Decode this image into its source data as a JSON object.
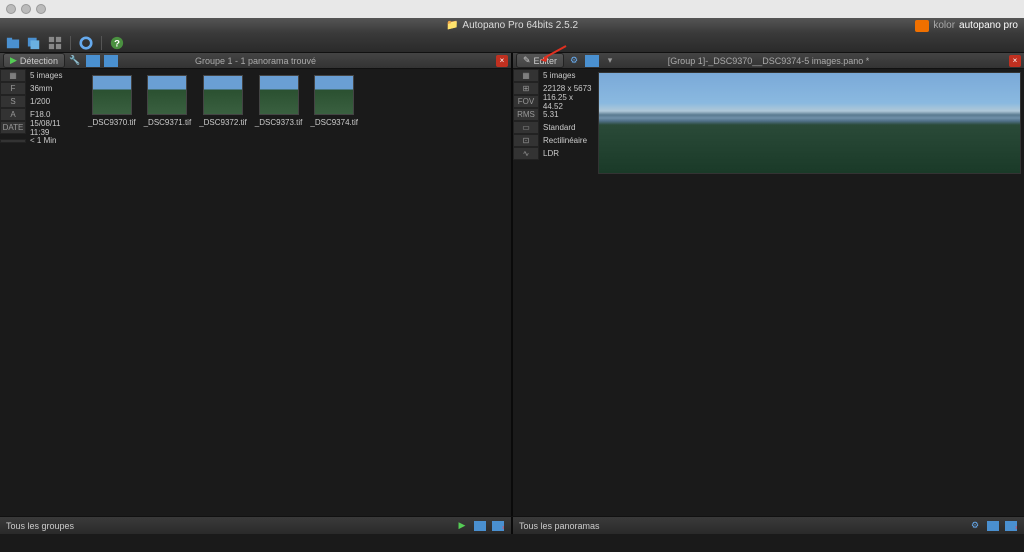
{
  "app": {
    "title": "Autopano Pro 64bits 2.5.2",
    "brand_prefix": "kolor",
    "brand_name": "autopano pro"
  },
  "left_pane": {
    "header_label": "Détection",
    "title": "Groupe 1 - 1 panorama trouvé",
    "meta": [
      {
        "key": "▦",
        "val": "5 images"
      },
      {
        "key": "F",
        "val": "36mm"
      },
      {
        "key": "S",
        "val": "1/200"
      },
      {
        "key": "A",
        "val": "F18.0"
      },
      {
        "key": "DATE",
        "val": "15/08/11 11:39"
      },
      {
        "key": "",
        "val": "< 1 Min"
      }
    ],
    "thumbs": [
      {
        "name": "_DSC9370.tif"
      },
      {
        "name": "_DSC9371.tif"
      },
      {
        "name": "_DSC9372.tif"
      },
      {
        "name": "_DSC9373.tif"
      },
      {
        "name": "_DSC9374.tif"
      }
    ]
  },
  "right_pane": {
    "header_label": "Editer",
    "title": "[Group 1]-_DSC9370__DSC9374-5 images.pano *",
    "meta": [
      {
        "key": "▦",
        "val": "5 images"
      },
      {
        "key": "⊞",
        "val": "22128 x 5673"
      },
      {
        "key": "FOV",
        "val": "116.25 x 44.52"
      },
      {
        "key": "RMS",
        "val": "5.31"
      },
      {
        "key": "▭",
        "val": "Standard"
      },
      {
        "key": "⊡",
        "val": "Rectilinéaire"
      },
      {
        "key": "∿",
        "val": "LDR"
      }
    ]
  },
  "footer": {
    "left_label": "Tous les groupes",
    "right_label": "Tous les panoramas"
  }
}
